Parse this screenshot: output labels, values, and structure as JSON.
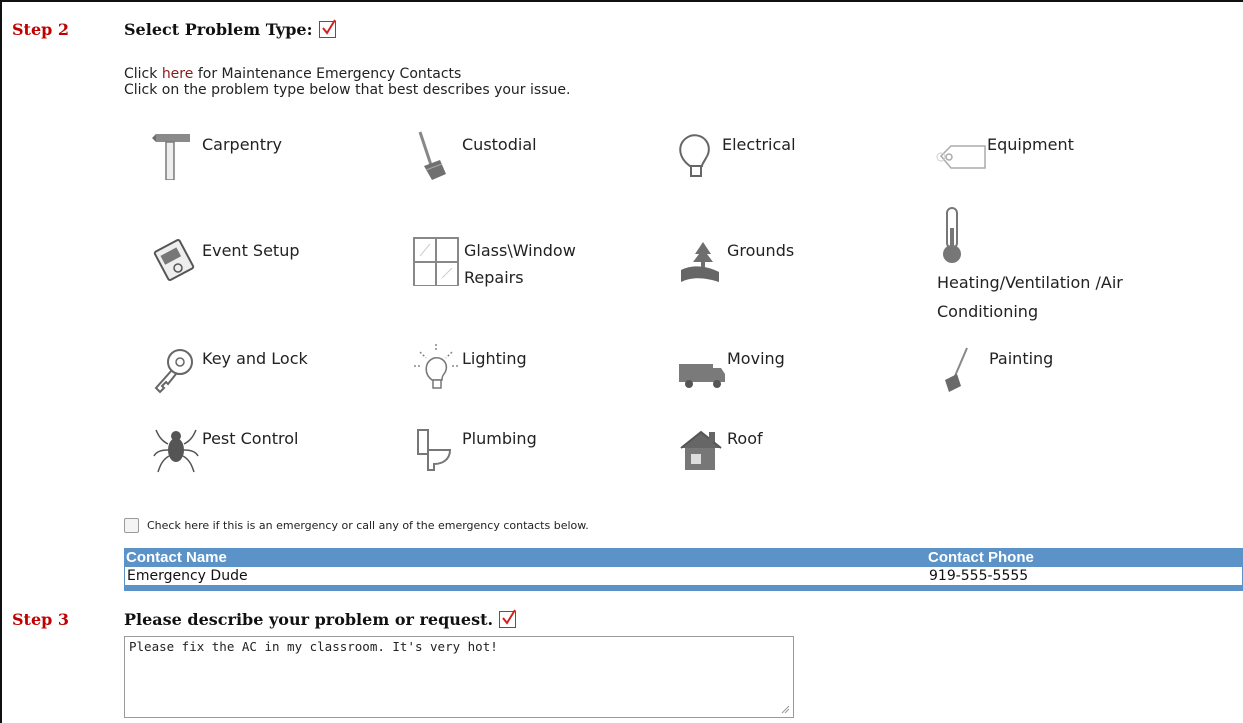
{
  "step2": {
    "label": "Step 2",
    "title": "Select Problem Type:",
    "intro_prefix": "Click ",
    "intro_link": "here",
    "intro_suffix": " for Maintenance Emergency Contacts",
    "intro_line2": "Click on the problem type below that best describes your issue."
  },
  "problem_types": [
    {
      "label": "Carpentry",
      "icon": "hammer-icon"
    },
    {
      "label": "Custodial",
      "icon": "broom-icon"
    },
    {
      "label": "Electrical",
      "icon": "light-bulb-icon"
    },
    {
      "label": "Equipment",
      "icon": "tag-icon"
    },
    {
      "label": "Event Setup",
      "icon": "event-card-icon"
    },
    {
      "label": "Glass\\Window",
      "label2": "Repairs",
      "icon": "window-icon"
    },
    {
      "label": "Grounds",
      "icon": "tree-icon"
    },
    {
      "label": "Heating/Ventilation /Air",
      "label2": "Conditioning",
      "icon": "thermometer-icon"
    },
    {
      "label": "Key and Lock",
      "icon": "key-icon"
    },
    {
      "label": "Lighting",
      "icon": "lit-bulb-icon"
    },
    {
      "label": "Moving",
      "icon": "truck-icon"
    },
    {
      "label": "Painting",
      "icon": "paintbrush-icon"
    },
    {
      "label": "Pest Control",
      "icon": "spider-icon"
    },
    {
      "label": "Plumbing",
      "icon": "toilet-icon"
    },
    {
      "label": "Roof",
      "icon": "house-icon"
    }
  ],
  "emergency": {
    "checkbox_label": "Check here if this is an emergency or call any of the emergency contacts below."
  },
  "contacts": {
    "headers": [
      "Contact Name",
      "Contact Phone"
    ],
    "rows": [
      [
        "Emergency Dude",
        "919-555-5555"
      ]
    ]
  },
  "step3": {
    "label": "Step 3",
    "title": "Please describe your problem or request.",
    "description_value": "Please fix the AC in my classroom.  It's very hot!"
  },
  "colors": {
    "step_red": "#c00000",
    "table_header_blue": "#5b93c9",
    "link_color": "#8b1a1a"
  }
}
